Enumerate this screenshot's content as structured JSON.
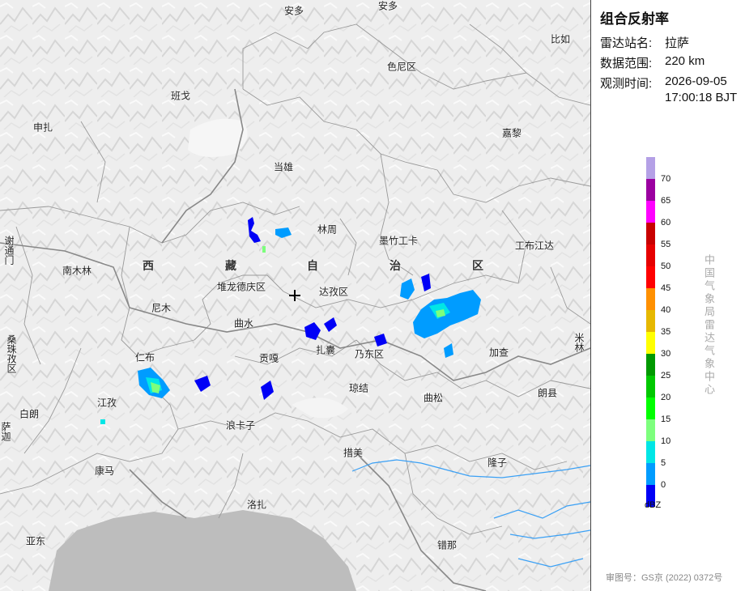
{
  "panel": {
    "title": "组合反射率",
    "station": {
      "label": "雷达站名:",
      "value": "拉萨"
    },
    "range": {
      "label": "数据范围:",
      "value": "220 km"
    },
    "time": {
      "label": "观测时间:",
      "date": "2026-09-05",
      "clock": "17:00:18 BJT"
    },
    "center_name": "中国气象局雷达气象中心",
    "approval": "审图号：GS京 (2022) 0372号"
  },
  "legend": {
    "unit": "dBZ",
    "ticks": [
      "70",
      "65",
      "60",
      "55",
      "50",
      "45",
      "40",
      "35",
      "30",
      "25",
      "20",
      "15",
      "10",
      "5",
      "0"
    ],
    "colors": [
      "#b4a0e6",
      "#9b00a0",
      "#ff00ff",
      "#c80000",
      "#e60000",
      "#ff0000",
      "#ff9000",
      "#e6b800",
      "#ffff00",
      "#009900",
      "#00c800",
      "#00ff00",
      "#7dff7d",
      "#00e6e6",
      "#009cff",
      "#0000f6"
    ]
  },
  "map": {
    "region_name": [
      "西",
      "藏",
      "自",
      "治",
      "区"
    ],
    "places": {
      "anduo1": "安多",
      "anduo2": "安多",
      "biru": "比如",
      "seni": "色尼区",
      "bange": "班戈",
      "shenzha": "申扎",
      "jiali": "嘉黎",
      "dangxiong": "当雄",
      "linzhou": "林周",
      "mozhugongka": "墨竹工卡",
      "gongbujiangda": "工布江达",
      "nanmulin": "南木林",
      "duilongdeqing": "堆龙德庆区",
      "dazi": "达孜区",
      "nimu": "尼木",
      "qushui": "曲水",
      "xietongmen": "谢通门",
      "sangzhutuo": "桑珠孜区",
      "renbu": "仁布",
      "gongga": "贡嘎",
      "zhanang": "扎囊",
      "naidong": "乃东区",
      "jiacha": "加查",
      "milin": "米林",
      "qiongjie": "琼结",
      "qusong": "曲松",
      "langxian": "朗县",
      "jiangzi": "江孜",
      "bailang": "白朗",
      "sajia": "萨迦",
      "langkazi": "浪卡子",
      "cuomei": "措美",
      "longzi": "隆子",
      "kangma": "康马",
      "luozha": "洛扎",
      "yadong": "亚东",
      "cuona": "错那"
    }
  }
}
